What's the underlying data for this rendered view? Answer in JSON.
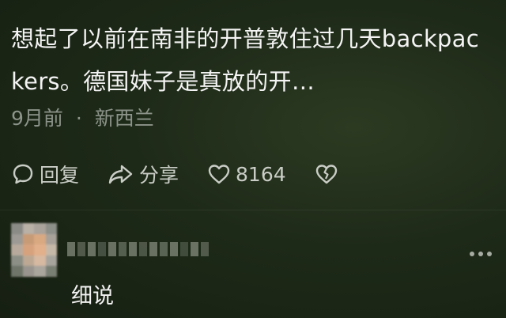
{
  "post": {
    "line1": "想起了以前在南非的开普敦住过几天backpac",
    "line2": "kers。德国妹子是真放的开…",
    "time": "9月前",
    "separator": "·",
    "location": "新西兰"
  },
  "actions": {
    "reply_label": "回复",
    "share_label": "分享",
    "like_count": "8164"
  },
  "comment": {
    "text": "细说"
  },
  "colors": {
    "background": "#1e2a18",
    "text": "#f4f4f4",
    "muted": "#8c938a"
  }
}
